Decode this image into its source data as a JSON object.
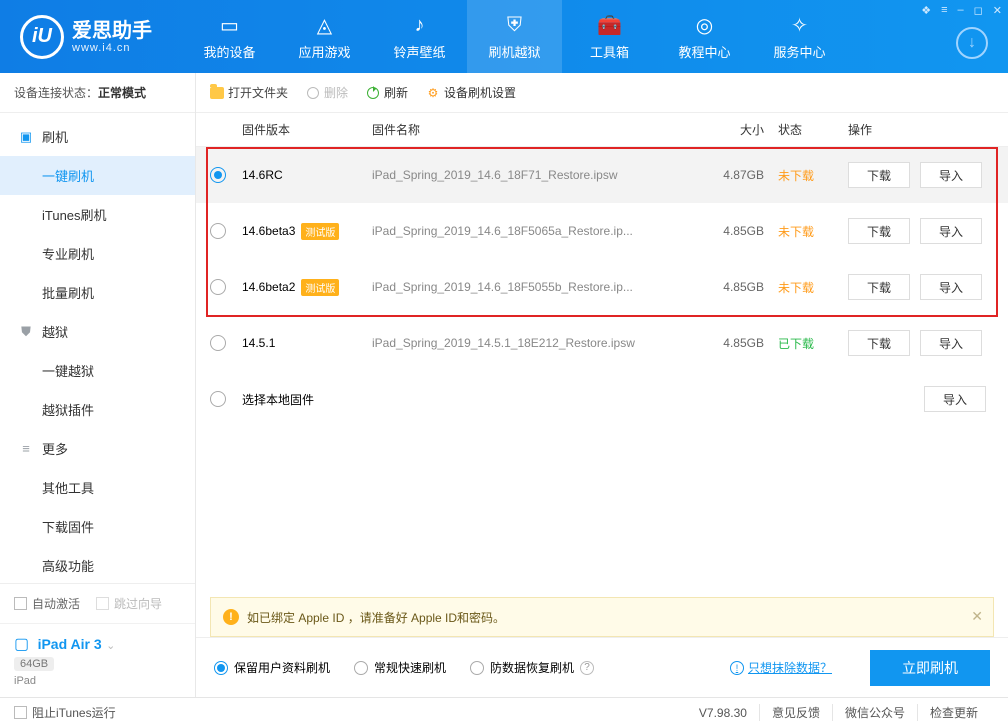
{
  "app": {
    "name": "爱思助手",
    "domain": "www.i4.cn",
    "logo_letter": "iU"
  },
  "window_controls": [
    "❖",
    "≡",
    "–",
    "◻",
    "✕"
  ],
  "nav": [
    {
      "label": "我的设备"
    },
    {
      "label": "应用游戏"
    },
    {
      "label": "铃声壁纸"
    },
    {
      "label": "刷机越狱"
    },
    {
      "label": "工具箱"
    },
    {
      "label": "教程中心"
    },
    {
      "label": "服务中心"
    }
  ],
  "nav_active_index": 3,
  "status": {
    "label": "设备连接状态：",
    "value": "正常模式"
  },
  "sidebar": {
    "groups": [
      {
        "label": "刷机",
        "subs": [
          "一键刷机",
          "iTunes刷机",
          "专业刷机",
          "批量刷机"
        ],
        "active_sub": 0
      },
      {
        "label": "越狱",
        "subs": [
          "一键越狱",
          "越狱插件"
        ]
      },
      {
        "label": "更多",
        "subs": [
          "其他工具",
          "下载固件",
          "高级功能"
        ]
      }
    ],
    "bottom": {
      "auto_activate": "自动激活",
      "skip_guide": "跳过向导"
    },
    "device": {
      "name": "iPad Air 3",
      "storage": "64GB",
      "type": "iPad"
    }
  },
  "toolbar": {
    "open": "打开文件夹",
    "delete": "删除",
    "refresh": "刷新",
    "settings": "设备刷机设置"
  },
  "columns": {
    "version": "固件版本",
    "name": "固件名称",
    "size": "大小",
    "status": "状态",
    "ops": "操作"
  },
  "status_text": {
    "pending": "未下载",
    "done": "已下载"
  },
  "buttons": {
    "download": "下载",
    "import": "导入"
  },
  "rows": [
    {
      "ver": "14.6RC",
      "beta": false,
      "file": "iPad_Spring_2019_14.6_18F71_Restore.ipsw",
      "size": "4.87GB",
      "status": "pending",
      "selected": true,
      "ops": [
        "download",
        "import"
      ]
    },
    {
      "ver": "14.6beta3",
      "beta": true,
      "file": "iPad_Spring_2019_14.6_18F5065a_Restore.ip...",
      "size": "4.85GB",
      "status": "pending",
      "selected": false,
      "ops": [
        "download",
        "import"
      ]
    },
    {
      "ver": "14.6beta2",
      "beta": true,
      "file": "iPad_Spring_2019_14.6_18F5055b_Restore.ip...",
      "size": "4.85GB",
      "status": "pending",
      "selected": false,
      "ops": [
        "download",
        "import"
      ]
    },
    {
      "ver": "14.5.1",
      "beta": false,
      "file": "iPad_Spring_2019_14.5.1_18E212_Restore.ipsw",
      "size": "4.85GB",
      "status": "done",
      "selected": false,
      "ops": [
        "download",
        "import"
      ]
    },
    {
      "ver": "选择本地固件",
      "beta": false,
      "file": "",
      "size": "",
      "status": "",
      "selected": false,
      "ops": [
        "import"
      ]
    }
  ],
  "beta_label": "测试版",
  "notice": "如已绑定 Apple ID ，请准备好 Apple ID和密码。",
  "action": {
    "modes": [
      "保留用户资料刷机",
      "常规快速刷机",
      "防数据恢复刷机"
    ],
    "selected_mode": 0,
    "erase_link": "只想抹除数据？",
    "go": "立即刷机"
  },
  "footer": {
    "block_itunes": "阻止iTunes运行",
    "version": "V7.98.30",
    "items": [
      "意见反馈",
      "微信公众号",
      "检查更新"
    ]
  }
}
